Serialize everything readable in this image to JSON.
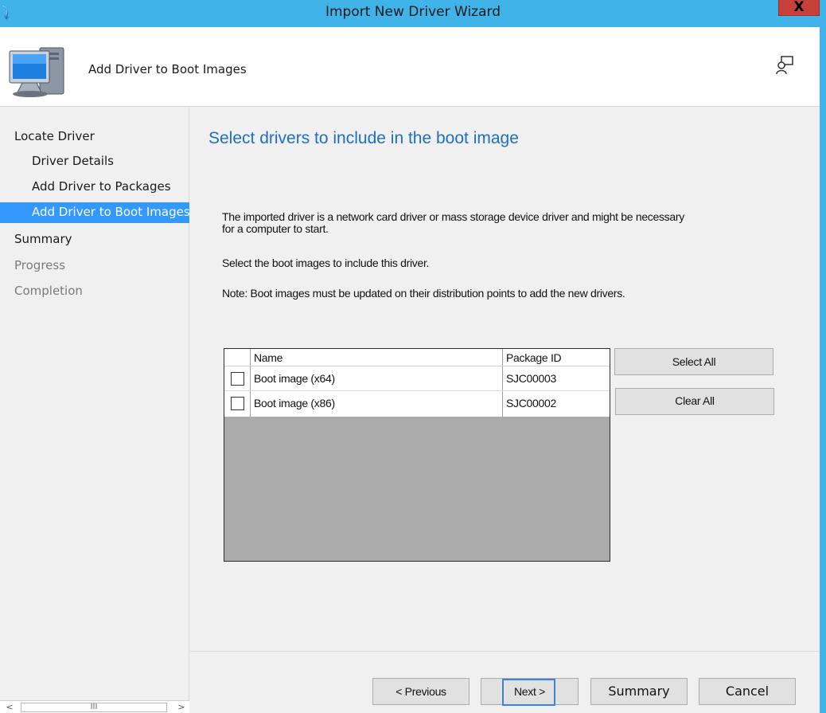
{
  "window": {
    "title": "Import New Driver Wizard",
    "close_glyph": "X",
    "app_icon": "wizard-arrow-icon"
  },
  "header": {
    "icon": "computer-icon",
    "title": "Add Driver to Boot Images",
    "help_icon": "help-person-icon"
  },
  "nav": {
    "items": [
      {
        "label": "Locate Driver",
        "level": 0,
        "state": "normal"
      },
      {
        "label": "Driver Details",
        "level": 1,
        "state": "normal"
      },
      {
        "label": "Add Driver to Packages",
        "level": 1,
        "state": "normal"
      },
      {
        "label": "Add Driver to Boot Images",
        "level": 1,
        "state": "selected"
      },
      {
        "label": "Summary",
        "level": 0,
        "state": "normal"
      },
      {
        "label": "Progress",
        "level": 0,
        "state": "disabled"
      },
      {
        "label": "Completion",
        "level": 0,
        "state": "disabled"
      }
    ],
    "scrollbar": {
      "left_arrow": "<",
      "thumb_grip": "III",
      "right_arrow": ">"
    }
  },
  "main": {
    "title": "Select drivers to include in the boot image",
    "description_line1": "The imported driver is a network card driver or mass storage device driver and might be necessary",
    "description_line2": "for a computer to start.",
    "instruction": "Select the boot images to include this driver.",
    "note": "Note: Boot images must be updated on their distribution points to add the new drivers."
  },
  "grid": {
    "columns": [
      "Name",
      "Package ID"
    ],
    "rows": [
      {
        "checked": false,
        "name": "Boot image (x64)",
        "package_id": "SJC00003"
      },
      {
        "checked": false,
        "name": "Boot image (x86)",
        "package_id": "SJC00002"
      }
    ]
  },
  "buttons": {
    "select_all": "Select All",
    "clear_all": "Clear All",
    "previous": "< Previous",
    "next": "Next >",
    "summary": "Summary",
    "cancel": "Cancel"
  },
  "colors": {
    "titlebar": "#40b3e8",
    "close_button": "#c7413b",
    "heading": "#1e6fbf",
    "nav_selected": "#3399ff",
    "grid_empty": "#ababab",
    "focus_border": "#3f83d4"
  }
}
